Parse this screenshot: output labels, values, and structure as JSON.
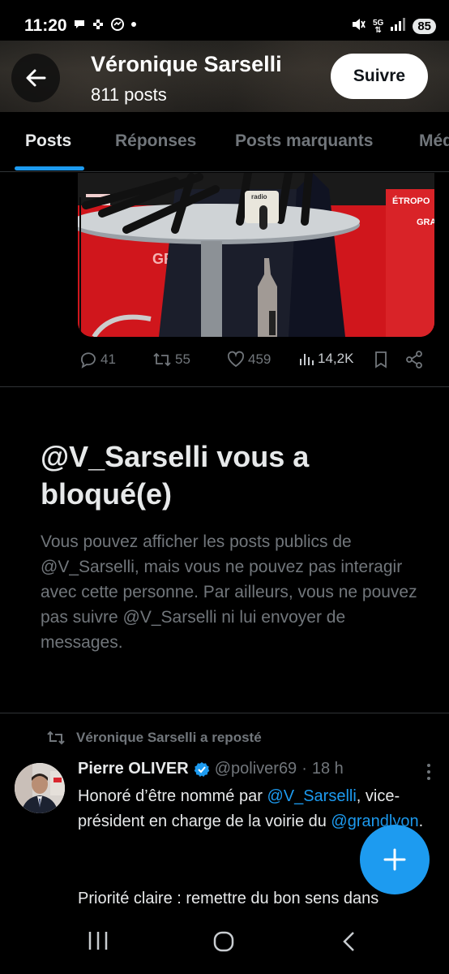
{
  "status": {
    "time": "11:20",
    "network": "5G",
    "battery": "85"
  },
  "header": {
    "name": "Véronique Sarselli",
    "posts_count": "811 posts",
    "follow_label": "Suivre"
  },
  "tabs": [
    {
      "label": "Posts"
    },
    {
      "label": "Réponses"
    },
    {
      "label": "Posts marquants"
    },
    {
      "label": "Méd"
    }
  ],
  "media": {
    "sign_text_1": "ÉTROPO",
    "sign_text_2": "GRA",
    "sign_text_3": "GRA",
    "sign_text_4": "radio"
  },
  "post_actions": {
    "replies": "41",
    "reposts": "55",
    "likes": "459",
    "views": "14,2K"
  },
  "blocked": {
    "title": "@V_Sarselli vous a bloqué(e)",
    "text": "Vous pouvez afficher les posts publics de @V_Sarselli, mais vous ne pouvez pas interagir avec cette personne. Par ailleurs, vous ne pouvez pas suivre @V_Sarselli ni lui envoyer de messages."
  },
  "repost": {
    "label": "Véronique Sarselli a reposté",
    "author_name": "Pierre OLIVER",
    "author_handle": "@poliver69",
    "dot": "·",
    "time": "18 h",
    "text_part1": "Honoré d’être nommé par ",
    "mention1": "@V_Sarselli",
    "text_part2": ", vice-président en charge de la voirie du ",
    "mention2": "@grandlyon",
    "text_part3": ".",
    "text_line2": "Priorité claire : remettre du bon sens dans"
  },
  "colors": {
    "accent": "#1d9bf0",
    "background": "#000000",
    "muted_text": "#71767b"
  }
}
